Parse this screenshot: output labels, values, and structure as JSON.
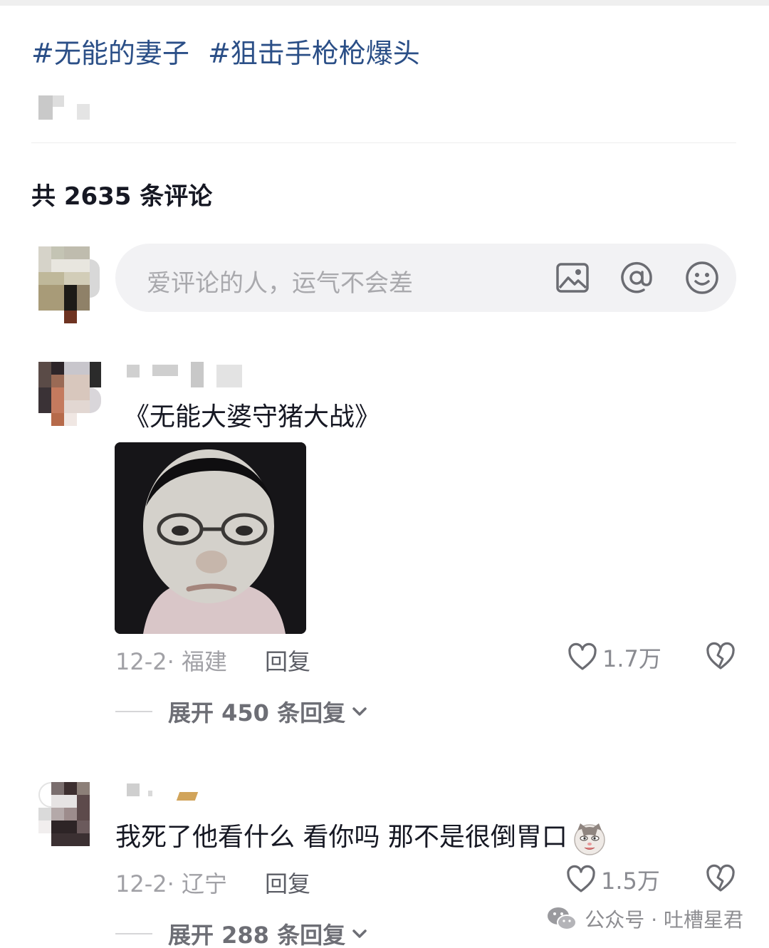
{
  "post": {
    "hashtags": [
      "#无能的妻子",
      "#狙击手枪枪爆头"
    ]
  },
  "comments_header": {
    "count_text": "共 2635 条评论"
  },
  "comment_input": {
    "placeholder": "爱评论的人，运气不会差",
    "icons": [
      "image-icon",
      "at-mention-icon",
      "emoji-icon"
    ]
  },
  "comments": [
    {
      "text": "《无能大婆守猪大战》",
      "has_image": true,
      "date_location": "12-2· 福建",
      "reply_label": "回复",
      "likes": "1.7万",
      "expand_label": "展开 450 条回复"
    },
    {
      "text": "我死了他看什么 看你吗 那不是很倒胃口",
      "emoji": "cat-emoji",
      "date_location": "12-2· 辽宁",
      "reply_label": "回复",
      "likes": "1.5万",
      "expand_label": "展开 288 条回复"
    }
  ],
  "watermark": {
    "text": "公众号 · 吐槽星君",
    "icon": "wechat-icon"
  }
}
